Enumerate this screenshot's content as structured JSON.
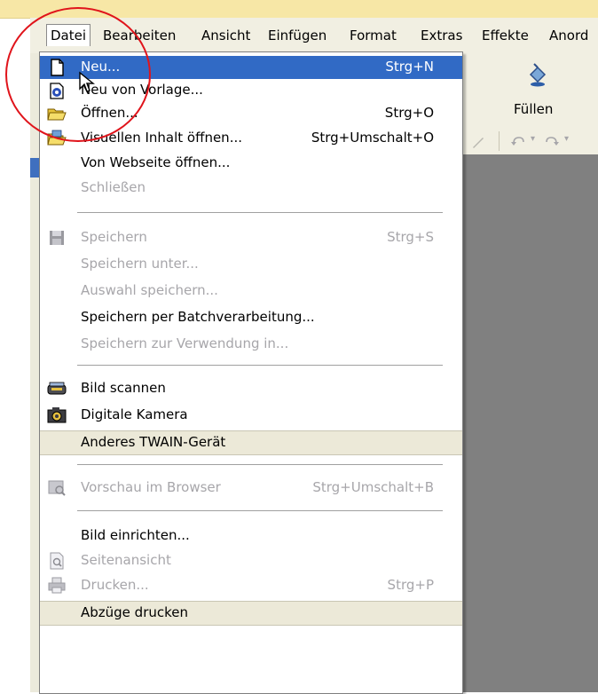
{
  "menubar": {
    "items": [
      "Datei",
      "Bearbeiten",
      "Ansicht",
      "Einfügen",
      "Format",
      "Extras",
      "Effekte",
      "Anord"
    ]
  },
  "toolbar": {
    "fill_label": "Füllen"
  },
  "file_menu": {
    "items": [
      {
        "label": "Neu...",
        "shortcut": "Strg+N",
        "icon": "new-document-icon",
        "state": "highlighted"
      },
      {
        "label": "Neu von Vorlage...",
        "shortcut": "",
        "icon": "template-icon",
        "state": "enabled"
      },
      {
        "label": "Öffnen...",
        "shortcut": "Strg+O",
        "icon": "open-folder-icon",
        "state": "enabled"
      },
      {
        "label": "Visuellen Inhalt öffnen...",
        "shortcut": "Strg+Umschalt+O",
        "icon": "visual-open-icon",
        "state": "enabled"
      },
      {
        "label": "Von Webseite öffnen...",
        "shortcut": "",
        "icon": "",
        "state": "enabled"
      },
      {
        "label": "Schließen",
        "shortcut": "",
        "icon": "",
        "state": "disabled"
      },
      {
        "label": "Speichern",
        "shortcut": "Strg+S",
        "icon": "save-disk-icon",
        "state": "disabled"
      },
      {
        "label": "Speichern unter...",
        "shortcut": "",
        "icon": "",
        "state": "disabled"
      },
      {
        "label": "Auswahl speichern...",
        "shortcut": "",
        "icon": "",
        "state": "disabled"
      },
      {
        "label": "Speichern per Batchverarbeitung...",
        "shortcut": "",
        "icon": "",
        "state": "enabled"
      },
      {
        "label": "Speichern zur Verwendung in...",
        "shortcut": "",
        "icon": "",
        "state": "disabled"
      },
      {
        "label": "Bild scannen",
        "shortcut": "",
        "icon": "scanner-icon",
        "state": "enabled"
      },
      {
        "label": "Digitale Kamera",
        "shortcut": "",
        "icon": "camera-icon",
        "state": "enabled"
      },
      {
        "label": "Anderes TWAIN-Gerät",
        "shortcut": "",
        "icon": "",
        "state": "hover"
      },
      {
        "label": "Vorschau im Browser",
        "shortcut": "Strg+Umschalt+B",
        "icon": "browser-preview-icon",
        "state": "disabled"
      },
      {
        "label": "Bild einrichten...",
        "shortcut": "",
        "icon": "",
        "state": "enabled"
      },
      {
        "label": "Seitenansicht",
        "shortcut": "",
        "icon": "page-preview-icon",
        "state": "disabled"
      },
      {
        "label": "Drucken...",
        "shortcut": "Strg+P",
        "icon": "printer-icon",
        "state": "disabled"
      },
      {
        "label": "Abzüge drucken",
        "shortcut": "",
        "icon": "",
        "state": "hover"
      }
    ]
  },
  "colors": {
    "highlight": "#316ac5",
    "annotation_circle": "#e0141b",
    "title_strip": "#f7e7a6"
  }
}
